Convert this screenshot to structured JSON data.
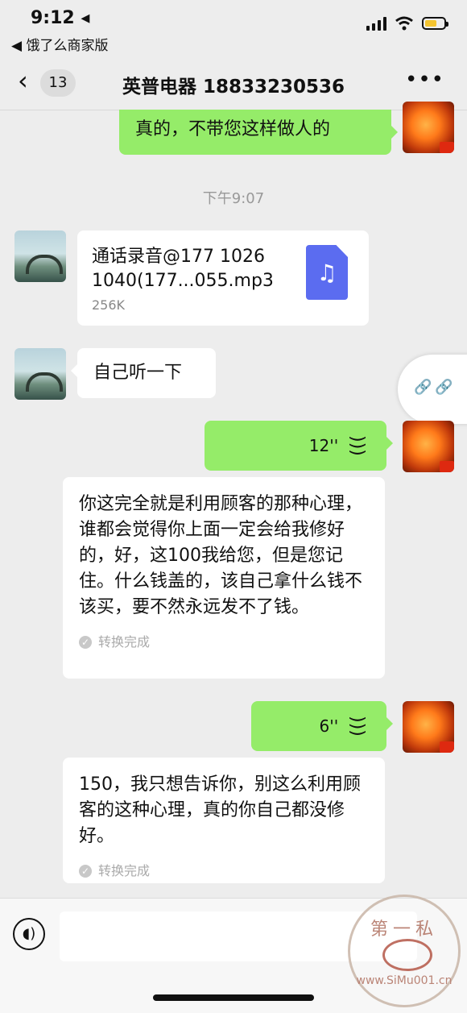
{
  "status_bar": {
    "time": "9:12 ◂",
    "back_app": "◀ 饿了么商家版"
  },
  "nav": {
    "unread_count": "13",
    "title": "英普电器 18833230536"
  },
  "messages": {
    "m1_text": "真的，不带您这样做人的",
    "timestamp": "下午9:07",
    "file": {
      "name": "通话录音@177 1026 1040(177...055.mp3",
      "size": "256K"
    },
    "m3_text": "自己听一下",
    "voice1": {
      "duration": "12''"
    },
    "transcript1": {
      "text": "你这完全就是利用顾客的那种心理，谁都会觉得你上面一定会给我修好的，好，这100我给您，但是您记住。什么钱盖的，该自己拿什么钱不该买，要不然永远发不了钱。",
      "status": "转换完成"
    },
    "voice2": {
      "duration": "6''"
    },
    "transcript2": {
      "text": "150，我只想告诉你，别这么利用顾客的这种心理，真的你自己都没修好。",
      "status": "转换完成"
    }
  },
  "watermark": {
    "top": "第一私",
    "bottom": "www.SiMu001.cn"
  },
  "icons": [
    "location-arrow-icon",
    "signal-icon",
    "wifi-icon",
    "battery-icon",
    "chevron-left-icon",
    "more-icon",
    "music-note-icon",
    "voice-wave-icon",
    "check-icon",
    "link-icon",
    "voice-toggle-icon"
  ],
  "colors": {
    "sent_bubble": "#95ec69",
    "received_bubble": "#ffffff",
    "background": "#ededed",
    "file_icon": "#5b6cf0"
  }
}
